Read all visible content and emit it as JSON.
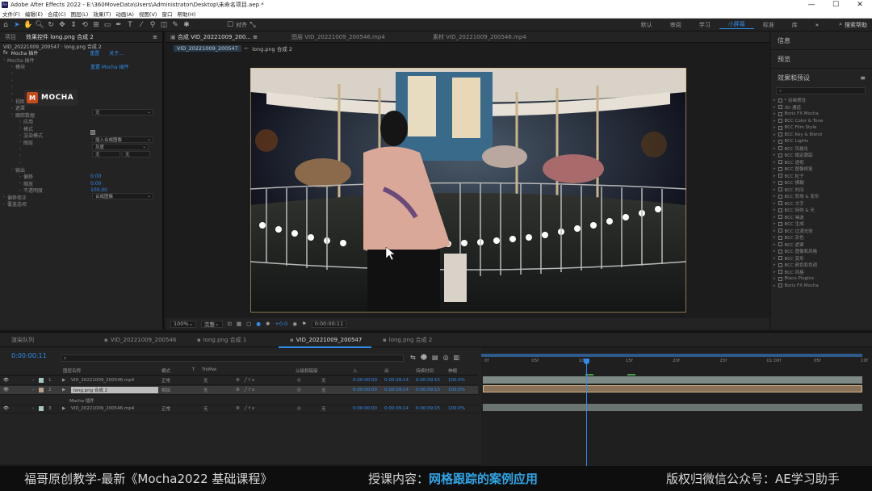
{
  "window": {
    "title": "Adobe After Effects 2022 - E:\\360MoveData\\Users\\Administrator\\Desktop\\未命名项目.aep *",
    "controls": [
      "—",
      "☐",
      "✕"
    ]
  },
  "menu": [
    "文件(F)",
    "编辑(E)",
    "合成(C)",
    "图层(L)",
    "效果(T)",
    "动画(A)",
    "视图(V)",
    "窗口",
    "帮助(H)"
  ],
  "toolbar": {
    "align_label": "对齐",
    "workspaces": [
      "默认",
      "审阅",
      "学习",
      "小屏幕",
      "标准",
      "库"
    ],
    "active_workspace": "小屏幕",
    "search_help": "搜索帮助"
  },
  "left_panel": {
    "tabs": [
      "项目",
      "效果控件 long.png 合成 2"
    ],
    "header": "VID_20221009_200547 · long.png 合成 2",
    "effect_name": "Mocha 插件",
    "reset_label": "重置",
    "about_label": "关于...",
    "logo_text": "MOCHA",
    "rows": [
      {
        "label": "Mocha 插件",
        "value": "",
        "indent": 0
      },
      {
        "label": "模块",
        "value": "重置   Mocha 插件",
        "indent": 1
      },
      {
        "label": "",
        "value": "",
        "indent": 1
      },
      {
        "label": "",
        "value": "",
        "indent": 1
      },
      {
        "label": "",
        "value": "",
        "indent": 1
      },
      {
        "label": "",
        "value": "",
        "indent": 1
      },
      {
        "label": "视图",
        "value": "",
        "indent": 1
      },
      {
        "label": "遮罩",
        "value": "",
        "indent": 1
      },
      {
        "label": "跟踪数据",
        "value": "",
        "indent": 1
      },
      {
        "label": "应用",
        "value": "",
        "indent": 2
      },
      {
        "label": "模式",
        "value": "",
        "indent": 2
      },
      {
        "label": "渲染模式",
        "value": "",
        "indent": 2
      },
      {
        "label": "图层",
        "value": "",
        "indent": 2
      },
      {
        "label": "",
        "value": "",
        "indent": 2
      },
      {
        "label": "",
        "value": "",
        "indent": 2
      },
      {
        "label": "",
        "value": "",
        "indent": 2
      },
      {
        "label": "输出",
        "value": "",
        "indent": 1
      },
      {
        "label": "偏移",
        "value": "0.00",
        "indent": 2
      },
      {
        "label": "缩放",
        "value": "0.00",
        "indent": 2
      },
      {
        "label": "不透明度",
        "value": "100.00",
        "indent": 2
      },
      {
        "label": "偏移修正",
        "value": "",
        "indent": 0
      },
      {
        "label": "覆盖选项",
        "value": "",
        "indent": 0
      }
    ],
    "dropdowns": {
      "view": "无",
      "mode": "插入合成图像",
      "render": "灰度",
      "layer1": "无",
      "layer2": "无",
      "grade": "合成图像"
    }
  },
  "comp_panel": {
    "tabs": [
      "合成 VID_20221009_200...",
      "图层 VID_20221009_200546.mp4",
      "素材 VID_20221009_200546.mp4"
    ],
    "breadcrumb": [
      "VID_20221009_200547",
      "long.png 合成 2"
    ],
    "zoom": "100%",
    "resolution": "完整",
    "time": "0:00:00:11",
    "exposure": "+0.0"
  },
  "right_panel": {
    "sections": [
      "信息",
      "预览",
      "效果和预设"
    ],
    "search_placeholder": "",
    "fx_list": [
      "* 动画预设",
      "3D 通道",
      "Boris FX Mocha",
      "BCC Color & Tone",
      "BCC Film Style",
      "BCC Key & Blend",
      "BCC Lights",
      "BCC 风格化",
      "BCC 稳定跟踪",
      "BCC 透视",
      "BCC 图像修复",
      "BCC 粒子",
      "BCC 模糊",
      "BCC 时间",
      "BCC 转场 & 变形",
      "BCC 文字",
      "BCC 特效 & 光",
      "BCC 噪波",
      "BCC 生成",
      "BCC 过渡光效",
      "BCC 杂色",
      "BCC 遮罩",
      "BCC 图像和风格",
      "BCC 变形",
      "BCC 颜色和色调",
      "BCC 风格",
      "Blace Plugins",
      "Boris FX Mocha"
    ]
  },
  "timeline": {
    "tabs": [
      "渲染队列",
      "VID_20221009_200546",
      "long.png 合成 1",
      "VID_20221009_200547",
      "long.png 合成 2"
    ],
    "active_tab": "VID_20221009_200547",
    "timecode": "0:00:00:11",
    "headers": [
      "图层名称",
      "模式",
      "T",
      "TrkMat",
      "父级和链接",
      "入",
      "出",
      "持续时间",
      "伸缩"
    ],
    "layers": [
      {
        "num": "1",
        "name": "VID_20221009_200546.mp4",
        "mode": "正常",
        "trk": "无",
        "parent": "无",
        "in": "0:00:00:00",
        "out": "0:00:09:14",
        "dur": "0:00:09:15",
        "stretch": "100.0%",
        "color": "#a7c8c2",
        "selected": false
      },
      {
        "num": "2",
        "name": "long.png 合成 2",
        "mode": "相加",
        "trk": "无",
        "parent": "无",
        "in": "0:00:00:00",
        "out": "0:00:09:14",
        "dur": "0:00:09:15",
        "stretch": "100.0%",
        "color": "#b8a08a",
        "selected": true
      },
      {
        "num": "",
        "name": "Mocha 插件",
        "mode": "",
        "trk": "",
        "parent": "",
        "in": "",
        "out": "",
        "dur": "",
        "stretch": "",
        "color": "",
        "selected": false
      },
      {
        "num": "3",
        "name": "VID_20221009_200546.mp4",
        "mode": "正常",
        "trk": "无",
        "parent": "无",
        "in": "0:00:00:00",
        "out": "0:00:09:14",
        "dur": "0:00:09:15",
        "stretch": "100.0%",
        "color": "#a7c8c2",
        "selected": false
      }
    ],
    "ruler_labels": [
      "0f",
      "05f",
      "10f",
      "15f",
      "20f",
      "25f",
      "01:00f",
      "05f",
      "10f"
    ],
    "playhead_progress": 0.275
  },
  "subtitle": {
    "left": "福哥原创教学-最新《Mocha2022 基础课程》",
    "mid_prefix": "授课内容：",
    "mid_highlight": "网格跟踪的案例应用",
    "right": "版权归微信公众号：AE学习助手"
  },
  "colors": {
    "accent": "#2d8ceb",
    "subtitle_highlight": "#2fa6e6"
  }
}
